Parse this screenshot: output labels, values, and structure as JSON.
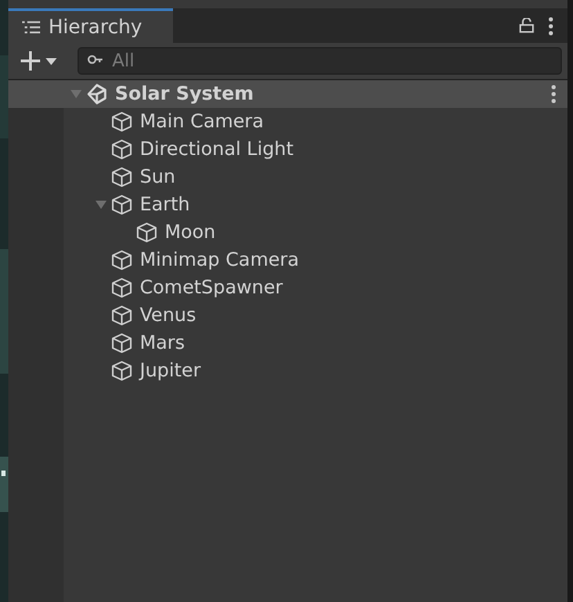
{
  "window": {
    "title": "Hierarchy"
  },
  "search": {
    "placeholder": "All"
  },
  "tree": [
    {
      "label": "Solar System",
      "kind": "scene",
      "expanded": true,
      "children": [
        {
          "label": "Main Camera",
          "kind": "object"
        },
        {
          "label": "Directional Light",
          "kind": "object"
        },
        {
          "label": "Sun",
          "kind": "object"
        },
        {
          "label": "Earth",
          "kind": "object",
          "expanded": true,
          "children": [
            {
              "label": "Moon",
              "kind": "object"
            }
          ]
        },
        {
          "label": "Minimap Camera",
          "kind": "object"
        },
        {
          "label": "CometSpawner",
          "kind": "object"
        },
        {
          "label": "Venus",
          "kind": "object"
        },
        {
          "label": "Mars",
          "kind": "object"
        },
        {
          "label": "Jupiter",
          "kind": "object"
        }
      ]
    }
  ]
}
